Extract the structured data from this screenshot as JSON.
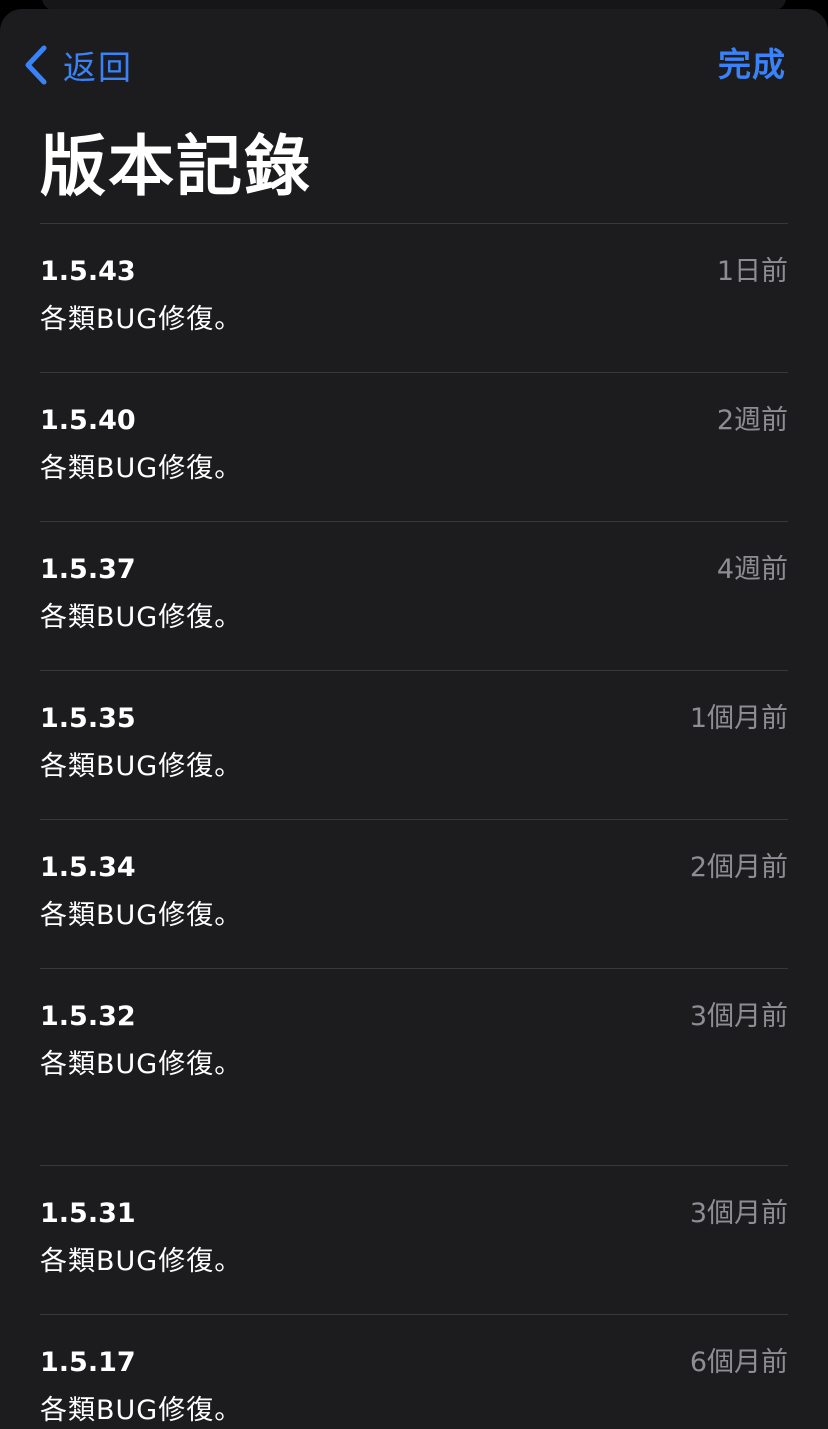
{
  "nav": {
    "back_label": "返回",
    "done_label": "完成"
  },
  "page": {
    "title": "版本記錄"
  },
  "releases": [
    {
      "version": "1.5.43",
      "date": "1日前",
      "notes": "各類BUG修復。"
    },
    {
      "version": "1.5.40",
      "date": "2週前",
      "notes": "各類BUG修復。"
    },
    {
      "version": "1.5.37",
      "date": "4週前",
      "notes": "各類BUG修復。"
    },
    {
      "version": "1.5.35",
      "date": "1個月前",
      "notes": "各類BUG修復。"
    },
    {
      "version": "1.5.34",
      "date": "2個月前",
      "notes": "各類BUG修復。"
    },
    {
      "version": "1.5.32",
      "date": "3個月前",
      "notes": "各類BUG修復。"
    },
    {
      "version": "1.5.31",
      "date": "3個月前",
      "notes": "各類BUG修復。"
    },
    {
      "version": "1.5.17",
      "date": "6個月前",
      "notes": "各類BUG修復。"
    }
  ],
  "colors": {
    "accent": "#3a82f7",
    "background": "#1c1c1e",
    "secondary_text": "#8d8d93",
    "separator": "#38383a"
  }
}
